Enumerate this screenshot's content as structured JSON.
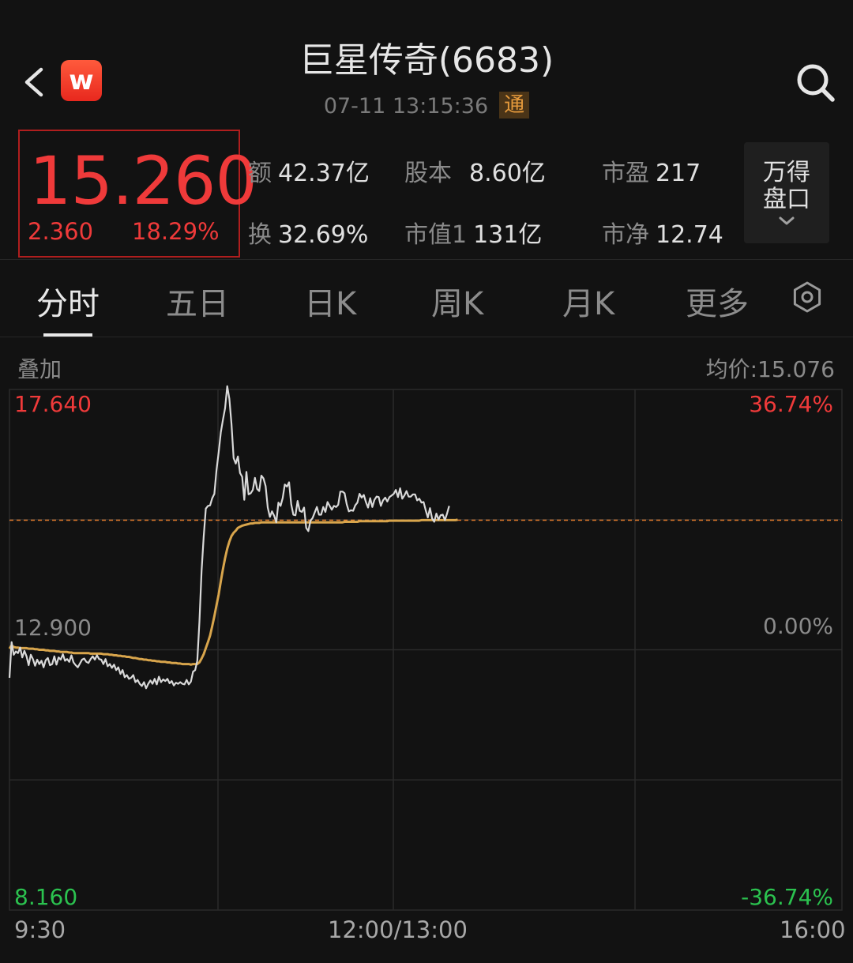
{
  "header": {
    "title": "巨星传奇(6683)",
    "timestamp": "07-11 13:15:36",
    "connect_badge": "通",
    "logo_letter": "w"
  },
  "quote": {
    "price": "15.260",
    "change": "2.360",
    "change_pct": "18.29%",
    "price_color": "#ef3a3a"
  },
  "stats": [
    {
      "label": "额",
      "value": "42.37亿"
    },
    {
      "label": "股本",
      "value": "8.60亿"
    },
    {
      "label": "市盈",
      "value": "217"
    },
    {
      "label": "换",
      "value": "32.69%"
    },
    {
      "label": "市值1",
      "value": "131亿"
    },
    {
      "label": "市净",
      "value": "12.74"
    }
  ],
  "wande_button": {
    "line1": "万得",
    "line2": "盘口"
  },
  "tabs": [
    "分时",
    "五日",
    "日K",
    "周K",
    "月K",
    "更多"
  ],
  "active_tab": 0,
  "overlay_label": "叠加",
  "avg_price_label": "均价:15.076",
  "chart_data": {
    "type": "line",
    "y_axis_left": {
      "top": "17.640",
      "mid": "12.900",
      "bottom": "8.160"
    },
    "y_axis_right": {
      "top": "36.74%",
      "mid": "0.00%",
      "bottom": "-36.74%"
    },
    "ylim": [
      8.16,
      17.64
    ],
    "prev_close": 12.9,
    "last_price": 15.26,
    "x_ticks": [
      "9:30",
      "12:00/13:00",
      "16:00"
    ],
    "colors": {
      "price_line": "#d9d9d9",
      "avg_line": "#d8a54c",
      "up": "#ef3a3a",
      "down": "#2bc24f",
      "ref_line": "#e07a2c",
      "grid": "#2a2a2a"
    },
    "series": [
      {
        "values": [
          12.39,
          13.04,
          12.81,
          12.87,
          12.84,
          12.94,
          12.76,
          12.88,
          12.78,
          12.62,
          12.81,
          12.73,
          12.61,
          12.72,
          12.64,
          12.7,
          12.58,
          12.71,
          12.75,
          12.62,
          12.64,
          12.78,
          12.63,
          12.76,
          12.72,
          12.82,
          12.7,
          12.73,
          12.68,
          12.8,
          12.67,
          12.62,
          12.58,
          12.65,
          12.72,
          12.74,
          12.68,
          12.66,
          12.73,
          12.78,
          12.72,
          12.8,
          12.73,
          12.72,
          12.64,
          12.73,
          12.6,
          12.64,
          12.57,
          12.63,
          12.53,
          12.58,
          12.46,
          12.53,
          12.4,
          12.44,
          12.37,
          12.39,
          12.44,
          12.31,
          12.35,
          12.28,
          12.24,
          12.31,
          12.2,
          12.28,
          12.34,
          12.28,
          12.37,
          12.27,
          12.41,
          12.31,
          12.36,
          12.33,
          12.37,
          12.29,
          12.33,
          12.25,
          12.3,
          12.28,
          12.31,
          12.28,
          12.27,
          12.35,
          12.27,
          12.32,
          12.5,
          12.53,
          12.7,
          13.41,
          14.33,
          14.96,
          15.47,
          15.52,
          15.53,
          15.66,
          15.74,
          16.17,
          16.5,
          16.86,
          17.09,
          17.3,
          17.7,
          17.47,
          17.01,
          16.39,
          16.29,
          16.42,
          16.12,
          16.05,
          15.63,
          16.14,
          15.73,
          15.75,
          15.81,
          16.03,
          15.83,
          15.79,
          16.07,
          16.02,
          15.88,
          15.49,
          15.32,
          15.42,
          15.34,
          15.22,
          15.58,
          15.52,
          15.66,
          15.91,
          15.87,
          15.95,
          15.55,
          15.36,
          15.35,
          15.61,
          15.43,
          15.41,
          15.49,
          15.12,
          15.06,
          15.25,
          15.3,
          15.4,
          15.5,
          15.36,
          15.36,
          15.5,
          15.41,
          15.59,
          15.52,
          15.45,
          15.52,
          15.5,
          15.54,
          15.78,
          15.78,
          15.75,
          15.55,
          15.42,
          15.44,
          15.43,
          15.53,
          15.58,
          15.74,
          15.67,
          15.72,
          15.59,
          15.49,
          15.66,
          15.5,
          15.63,
          15.69,
          15.68,
          15.52,
          15.62,
          15.67,
          15.6,
          15.68,
          15.71,
          15.74,
          15.81,
          15.68,
          15.84,
          15.65,
          15.71,
          15.79,
          15.69,
          15.69,
          15.73,
          15.73,
          15.62,
          15.65,
          15.58,
          15.59,
          15.44,
          15.31,
          15.48,
          15.29,
          15.23,
          15.38,
          15.27,
          15.35,
          15.36,
          15.26,
          15.38,
          15.52
        ]
      },
      {
        "values": [
          12.92,
          12.98,
          12.95,
          12.94,
          12.94,
          12.93,
          12.93,
          12.93,
          12.93,
          12.92,
          12.92,
          12.92,
          12.91,
          12.91,
          12.9,
          12.9,
          12.9,
          12.89,
          12.89,
          12.88,
          12.88,
          12.88,
          12.87,
          12.87,
          12.86,
          12.86,
          12.86,
          12.86,
          12.85,
          12.85,
          12.84,
          12.84,
          12.84,
          12.84,
          12.84,
          12.84,
          12.84,
          12.84,
          12.83,
          12.83,
          12.83,
          12.83,
          12.83,
          12.83,
          12.82,
          12.82,
          12.82,
          12.81,
          12.81,
          12.8,
          12.8,
          12.79,
          12.79,
          12.78,
          12.78,
          12.77,
          12.77,
          12.76,
          12.75,
          12.75,
          12.74,
          12.73,
          12.73,
          12.72,
          12.72,
          12.71,
          12.71,
          12.7,
          12.7,
          12.69,
          12.69,
          12.68,
          12.68,
          12.68,
          12.67,
          12.67,
          12.66,
          12.66,
          12.66,
          12.65,
          12.65,
          12.64,
          12.64,
          12.64,
          12.64,
          12.63,
          12.64,
          12.64,
          12.64,
          12.67,
          12.74,
          12.82,
          12.93,
          13.04,
          13.16,
          13.33,
          13.51,
          13.71,
          13.91,
          14.15,
          14.37,
          14.57,
          14.74,
          14.87,
          14.97,
          15.03,
          15.07,
          15.12,
          15.14,
          15.16,
          15.17,
          15.18,
          15.19,
          15.2,
          15.2,
          15.21,
          15.21,
          15.21,
          15.22,
          15.22,
          15.22,
          15.22,
          15.22,
          15.22,
          15.22,
          15.22,
          15.22,
          15.22,
          15.22,
          15.22,
          15.22,
          15.22,
          15.22,
          15.22,
          15.22,
          15.22,
          15.22,
          15.22,
          15.22,
          15.22,
          15.22,
          15.22,
          15.22,
          15.22,
          15.22,
          15.22,
          15.22,
          15.22,
          15.22,
          15.22,
          15.22,
          15.22,
          15.22,
          15.22,
          15.22,
          15.22,
          15.22,
          15.23,
          15.23,
          15.23,
          15.23,
          15.23,
          15.23,
          15.23,
          15.24,
          15.24,
          15.24,
          15.24,
          15.24,
          15.24,
          15.24,
          15.24,
          15.24,
          15.24,
          15.24,
          15.24,
          15.24,
          15.24,
          15.25,
          15.25,
          15.25,
          15.25,
          15.25,
          15.25,
          15.25,
          15.25,
          15.25,
          15.25,
          15.25,
          15.25,
          15.25,
          15.25,
          15.25,
          15.26,
          15.26,
          15.26,
          15.26,
          15.26,
          15.26,
          15.26,
          15.26,
          15.26,
          15.26,
          15.26,
          15.26,
          15.26,
          15.26,
          15.26,
          15.26,
          15.26,
          15.27
        ]
      }
    ]
  }
}
